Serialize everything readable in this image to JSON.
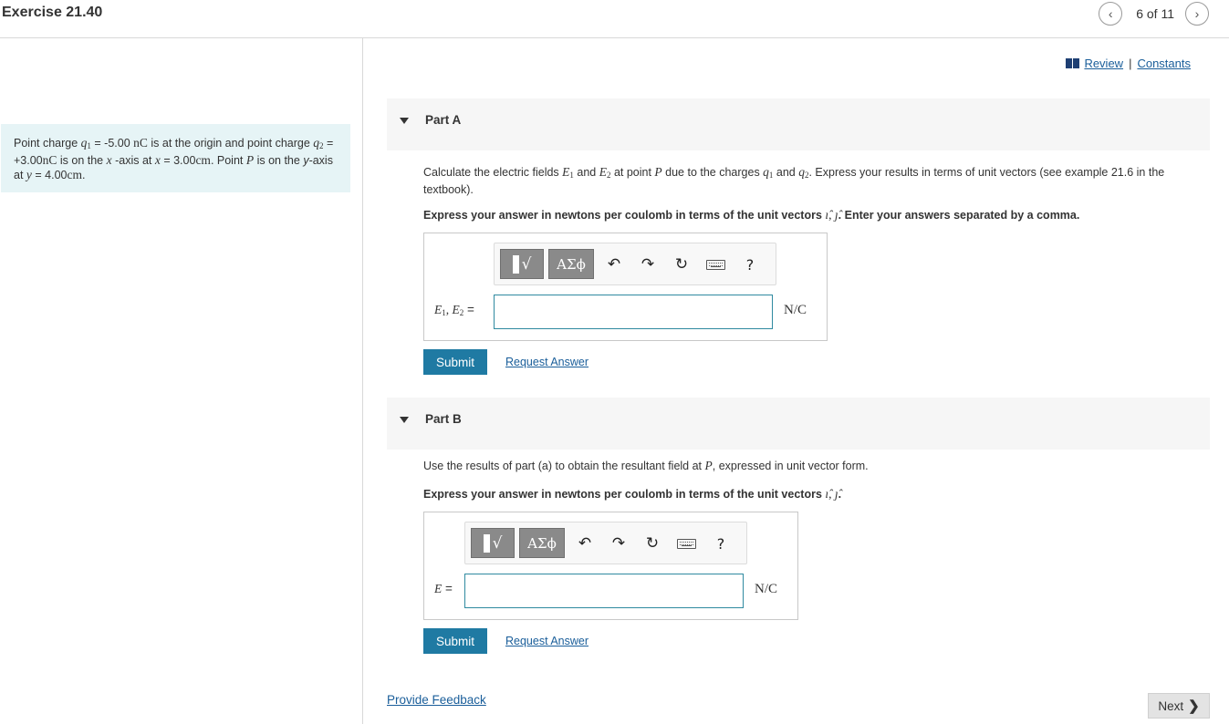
{
  "header": {
    "title": "Exercise 21.40",
    "nav_prev_icon": "‹",
    "nav_count": "6 of 11",
    "nav_next_icon": "›"
  },
  "links": {
    "review": "Review",
    "separator": "|",
    "constants": "Constants"
  },
  "problem": {
    "t1": "Point charge ",
    "q1": "q",
    "q1_sub": "1",
    "t2": " = -5.00 ",
    "nC1": "nC",
    "t3": " is at the origin and point charge ",
    "q2": "q",
    "q2_sub": "2",
    "t4": " = +3.00",
    "nC2": "nC",
    "t5": " is on the ",
    "x1": "x",
    "t6": " -axis at ",
    "x2": "x",
    "t7": " = 3.00",
    "cm1": "cm",
    "t8": ". Point ",
    "P": "P",
    "t9": " is on the ",
    "y1": "y",
    "t10": "-axis at ",
    "y2": "y",
    "t11": " = 4.00",
    "cm2": "cm",
    "t12": "."
  },
  "partA": {
    "label": "Part A",
    "q_t1": "Calculate the electric fields ",
    "E": "E",
    "E1_sub": "1",
    "q_and": " and ",
    "E2_sub": "2",
    "q_t2": " at point ",
    "P": "P",
    "q_t3": " due to the charges ",
    "q": "q",
    "q1_sub": "1",
    "q_and2": " and ",
    "q2_sub": "2",
    "q_t4": ". Express your results in terms of unit vectors (see example 21.6 in the textbook).",
    "instr_t1": "Express your answer in newtons per coulomb in terms of the unit vectors ",
    "unit_i": "ı̂",
    "comma": ", ",
    "unit_j": "ȷ̂",
    "instr_t2": ". Enter your answers separated by a comma.",
    "answer_label_E": "E",
    "answer_label_1": "1",
    "answer_label_sep": ", ",
    "answer_label_2": "2",
    "answer_label_eq": " =",
    "answer_value": "",
    "unit": "N/C",
    "submit": "Submit",
    "request": "Request Answer"
  },
  "partB": {
    "label": "Part B",
    "q_t1": "Use the results of part (a) to obtain the resultant field at ",
    "P": "P",
    "q_t2": ", expressed in unit vector form.",
    "instr_t1": "Express your answer in newtons per coulomb in terms of the unit vectors ",
    "unit_i": "ı̂",
    "comma": ", ",
    "unit_j": "ȷ̂",
    "instr_t2": ".",
    "answer_label_E": "E",
    "answer_label_eq": " =",
    "answer_value": "",
    "unit": "N/C",
    "submit": "Submit",
    "request": "Request Answer"
  },
  "toolbar": {
    "templates_icon": "√",
    "greek": "ΑΣϕ",
    "undo_icon": "↶",
    "redo_icon": "↷",
    "reset_icon": "↻",
    "help": "?"
  },
  "footer": {
    "feedback": "Provide Feedback",
    "next": "Next",
    "next_icon": "❯"
  }
}
